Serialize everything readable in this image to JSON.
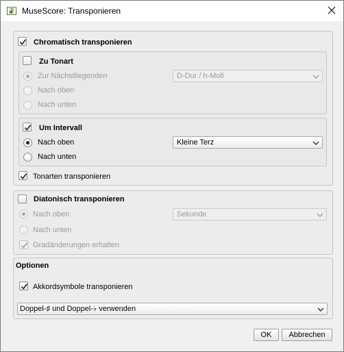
{
  "window": {
    "title": "MuseScore: Transponieren",
    "app_icon": "musescore-icon",
    "close_icon": "close-icon"
  },
  "chromatic": {
    "label": "Chromatisch transponieren",
    "checked": true,
    "to_key": {
      "label": "Zu Tonart",
      "checked": false,
      "options": [
        "Zur Nächstliegenden",
        "Nach oben",
        "Nach unten"
      ],
      "selected_option": 0,
      "key_select": "D-Dur / h-Moll"
    },
    "by_interval": {
      "label": "Um Intervall",
      "checked": true,
      "options": [
        "Nach oben",
        "Nach unten"
      ],
      "selected_option": 0,
      "interval_select": "Kleine Terz"
    },
    "transpose_keys": {
      "label": "Tonarten transponieren",
      "checked": true
    }
  },
  "diatonic": {
    "label": "Diatonisch transponieren",
    "checked": false,
    "options": [
      "Nach oben",
      "Nach unten"
    ],
    "selected_option": 0,
    "degree_select": "Sekunde",
    "keep_degree": {
      "label": "Gradänderungen erhalten",
      "checked": true
    }
  },
  "options": {
    "title": "Optionen",
    "chord_symbols": {
      "label": "Akkordsymbole transponieren",
      "checked": true
    },
    "accidental_select": "Doppel-♯ und Doppel-♭ verwenden"
  },
  "buttons": {
    "ok": "OK",
    "cancel": "Abbrechen"
  },
  "colors": {
    "window_bg": "#f0f0f0",
    "title_bg": "#ffffff",
    "disabled_text": "#9a9a9a"
  }
}
